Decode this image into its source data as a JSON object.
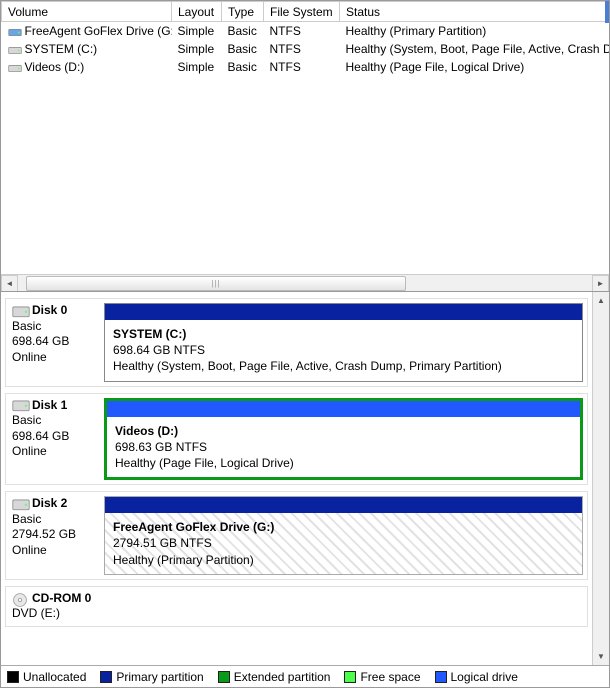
{
  "columns": {
    "volume": "Volume",
    "layout": "Layout",
    "type": "Type",
    "filesystem": "File System",
    "status": "Status"
  },
  "volumes": [
    {
      "icon": "hd-blue",
      "name": "FreeAgent GoFlex Drive (G:)",
      "layout": "Simple",
      "type": "Basic",
      "fs": "NTFS",
      "status": "Healthy (Primary Partition)"
    },
    {
      "icon": "hd-gray",
      "name": "SYSTEM (C:)",
      "layout": "Simple",
      "type": "Basic",
      "fs": "NTFS",
      "status": "Healthy (System, Boot, Page File, Active, Crash Du"
    },
    {
      "icon": "hd-gray",
      "name": "Videos (D:)",
      "layout": "Simple",
      "type": "Basic",
      "fs": "NTFS",
      "status": "Healthy (Page File, Logical Drive)"
    }
  ],
  "disks": [
    {
      "id": "Disk 0",
      "type": "Basic",
      "size": "698.64 GB",
      "state": "Online",
      "parts": [
        {
          "name": "SYSTEM  (C:)",
          "size": "698.64 GB NTFS",
          "status": "Healthy (System, Boot, Page File, Active, Crash Dump, Primary Partition)",
          "style": "navy"
        }
      ]
    },
    {
      "id": "Disk 1",
      "type": "Basic",
      "size": "698.64 GB",
      "state": "Online",
      "parts": [
        {
          "name": "Videos  (D:)",
          "size": "698.63 GB NTFS",
          "status": "Healthy (Page File, Logical Drive)",
          "style": "green blue"
        }
      ]
    },
    {
      "id": "Disk 2",
      "type": "Basic",
      "size": "2794.52 GB",
      "state": "Online",
      "parts": [
        {
          "name": "FreeAgent GoFlex Drive  (G:)",
          "size": "2794.51 GB NTFS",
          "status": "Healthy (Primary Partition)",
          "style": "navy hatch"
        }
      ]
    },
    {
      "id": "CD-ROM 0",
      "type": "DVD (E:)",
      "size": "",
      "state": "",
      "icon": "cd",
      "parts": []
    }
  ],
  "legend": {
    "unallocated": {
      "label": "Unallocated",
      "color": "#000000"
    },
    "primary": {
      "label": "Primary partition",
      "color": "#0822a0"
    },
    "extended": {
      "label": "Extended partition",
      "color": "#0b9a17"
    },
    "free": {
      "label": "Free space",
      "color": "#4bff4b"
    },
    "logical": {
      "label": "Logical drive",
      "color": "#2259ff"
    }
  }
}
